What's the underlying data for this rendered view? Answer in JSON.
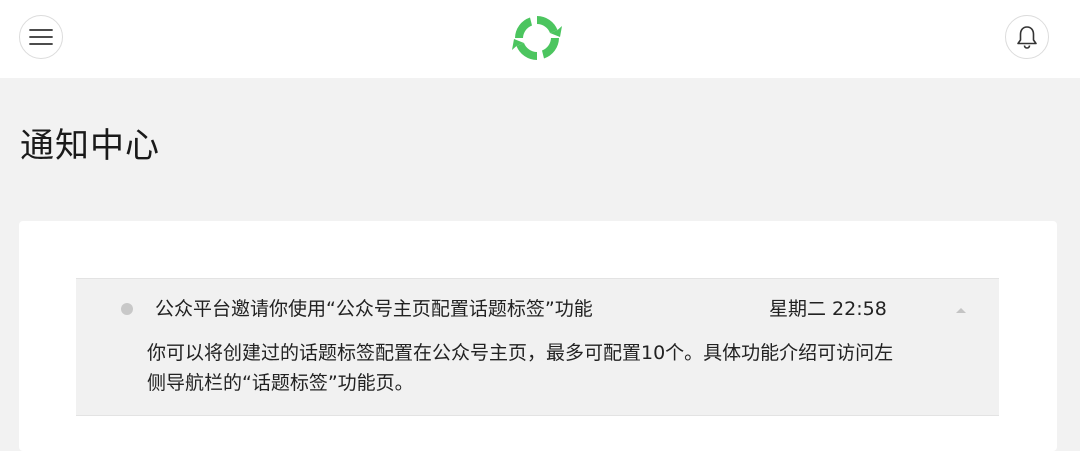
{
  "header": {
    "menu_icon": "hamburger-menu-icon",
    "logo_icon": "wechat-official-platform-logo",
    "bell_icon": "bell-icon",
    "brand_color": "#4cc55f"
  },
  "page": {
    "title": "通知中心"
  },
  "notifications": [
    {
      "title": "公众平台邀请你使用“公众号主页配置话题标签”功能",
      "time": "星期二 22:58",
      "body": "你可以将创建过的话题标签配置在公众号主页，最多可配置10个。具体功能介绍可访问左侧导航栏的“话题标签”功能页。",
      "expanded": true
    }
  ]
}
